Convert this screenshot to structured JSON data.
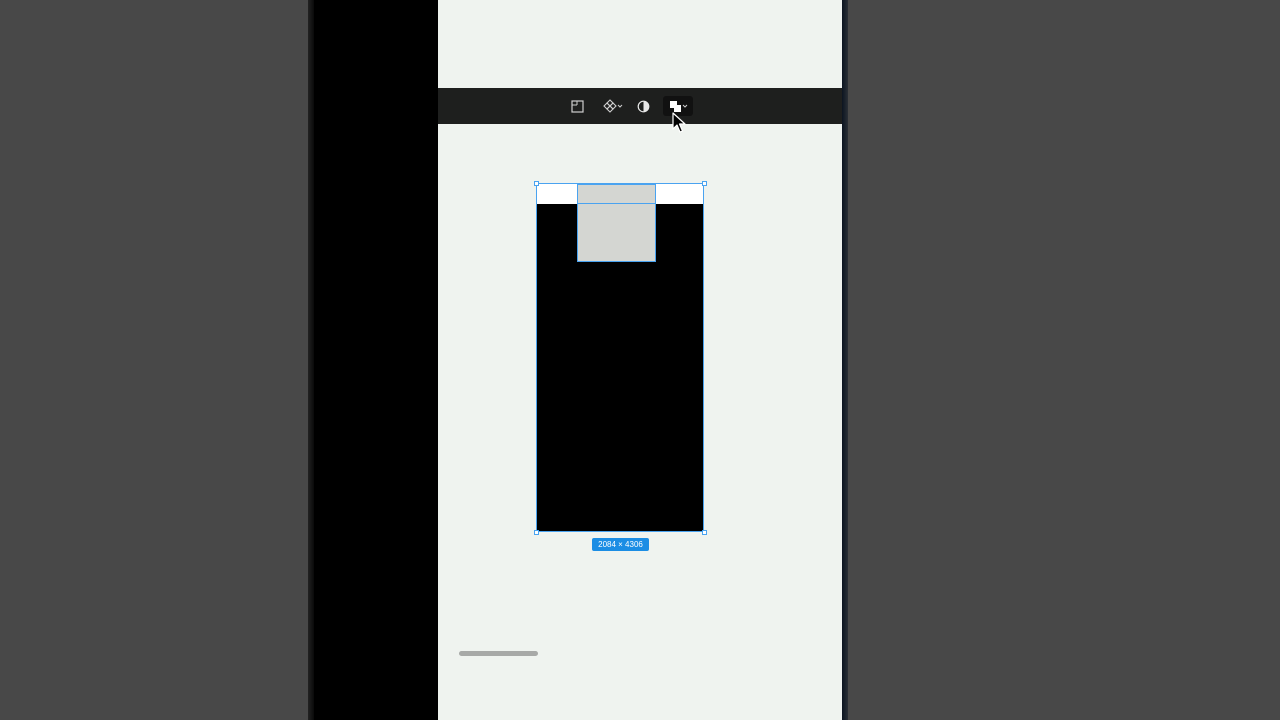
{
  "selection": {
    "dimensions": "2084 × 4306"
  },
  "toolbar": {
    "tools": [
      {
        "icon": "frame-icon"
      },
      {
        "icon": "component-icon",
        "has_dropdown": true
      },
      {
        "icon": "contrast-icon"
      },
      {
        "icon": "boolean-union-icon",
        "has_dropdown": true,
        "active": true
      }
    ]
  },
  "colors": {
    "canvas_bg": "#eff3ef",
    "toolbar_bg": "#1e1f1e",
    "selection_blue": "#4aa3f0",
    "badge_blue": "#1b8de4",
    "frame_fill": "#000000",
    "inner_fill": "#d4d6d2"
  }
}
